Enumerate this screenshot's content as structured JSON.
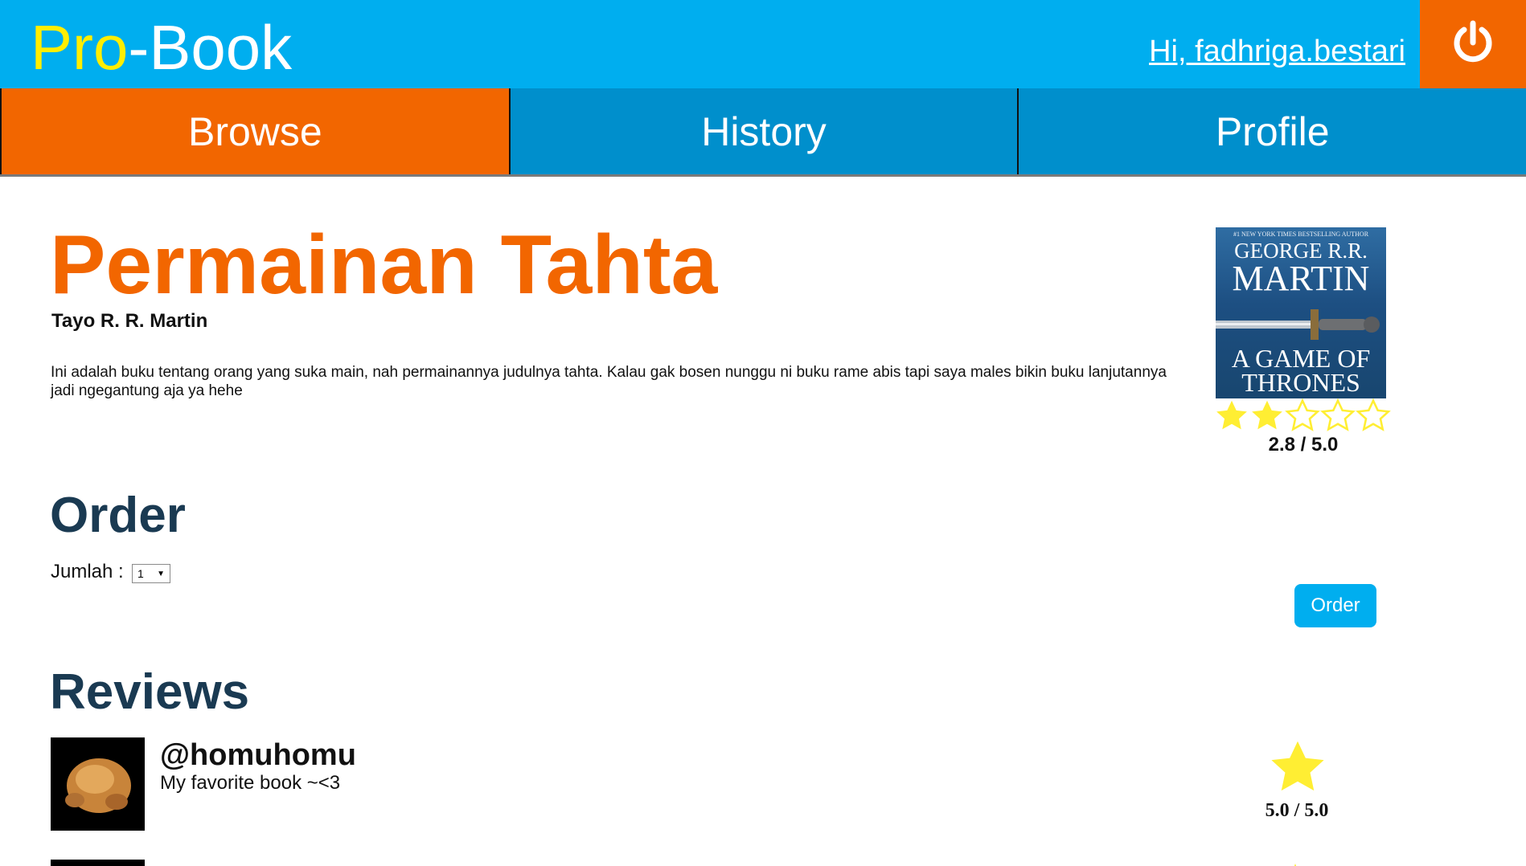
{
  "header": {
    "logo_part1": "Pro",
    "logo_part2": "-Book",
    "greeting": "Hi, fadhriga.bestari",
    "logout_icon": "power-icon"
  },
  "nav": {
    "tabs": [
      {
        "label": "Browse",
        "active": true
      },
      {
        "label": "History",
        "active": false
      },
      {
        "label": "Profile",
        "active": false
      }
    ]
  },
  "book": {
    "title": "Permainan Tahta",
    "author": "Tayo R. R. Martin",
    "description": "Ini adalah buku tentang orang yang suka main, nah permainannya judulnya tahta. Kalau gak bosen nunggu ni buku rame abis tapi saya males bikin buku lanjutannya jadi ngegantung aja ya hehe",
    "cover": {
      "tagline": "#1 NEW YORK TIMES BESTSELLING AUTHOR",
      "author_line1": "GEORGE R.R.",
      "author_line2": "MARTIN",
      "title_line1": "A GAME OF",
      "title_line2": "THRONES"
    },
    "rating": 2.8,
    "rating_text": "2.8 / 5.0",
    "stars_filled": 2,
    "stars_total": 5
  },
  "order": {
    "heading": "Order",
    "quantity_label": "Jumlah :",
    "quantity_value": "1",
    "button_label": "Order"
  },
  "reviews": {
    "heading": "Reviews",
    "items": [
      {
        "username": "@homuhomu",
        "comment": "My favorite book ~<3",
        "rating_text": "5.0 / 5.0"
      }
    ]
  },
  "colors": {
    "header_bg": "#00aeef",
    "accent_orange": "#f26600",
    "nav_bg": "#008fcc",
    "heading_dark": "#1a3a52",
    "star_yellow": "#ffee33"
  }
}
